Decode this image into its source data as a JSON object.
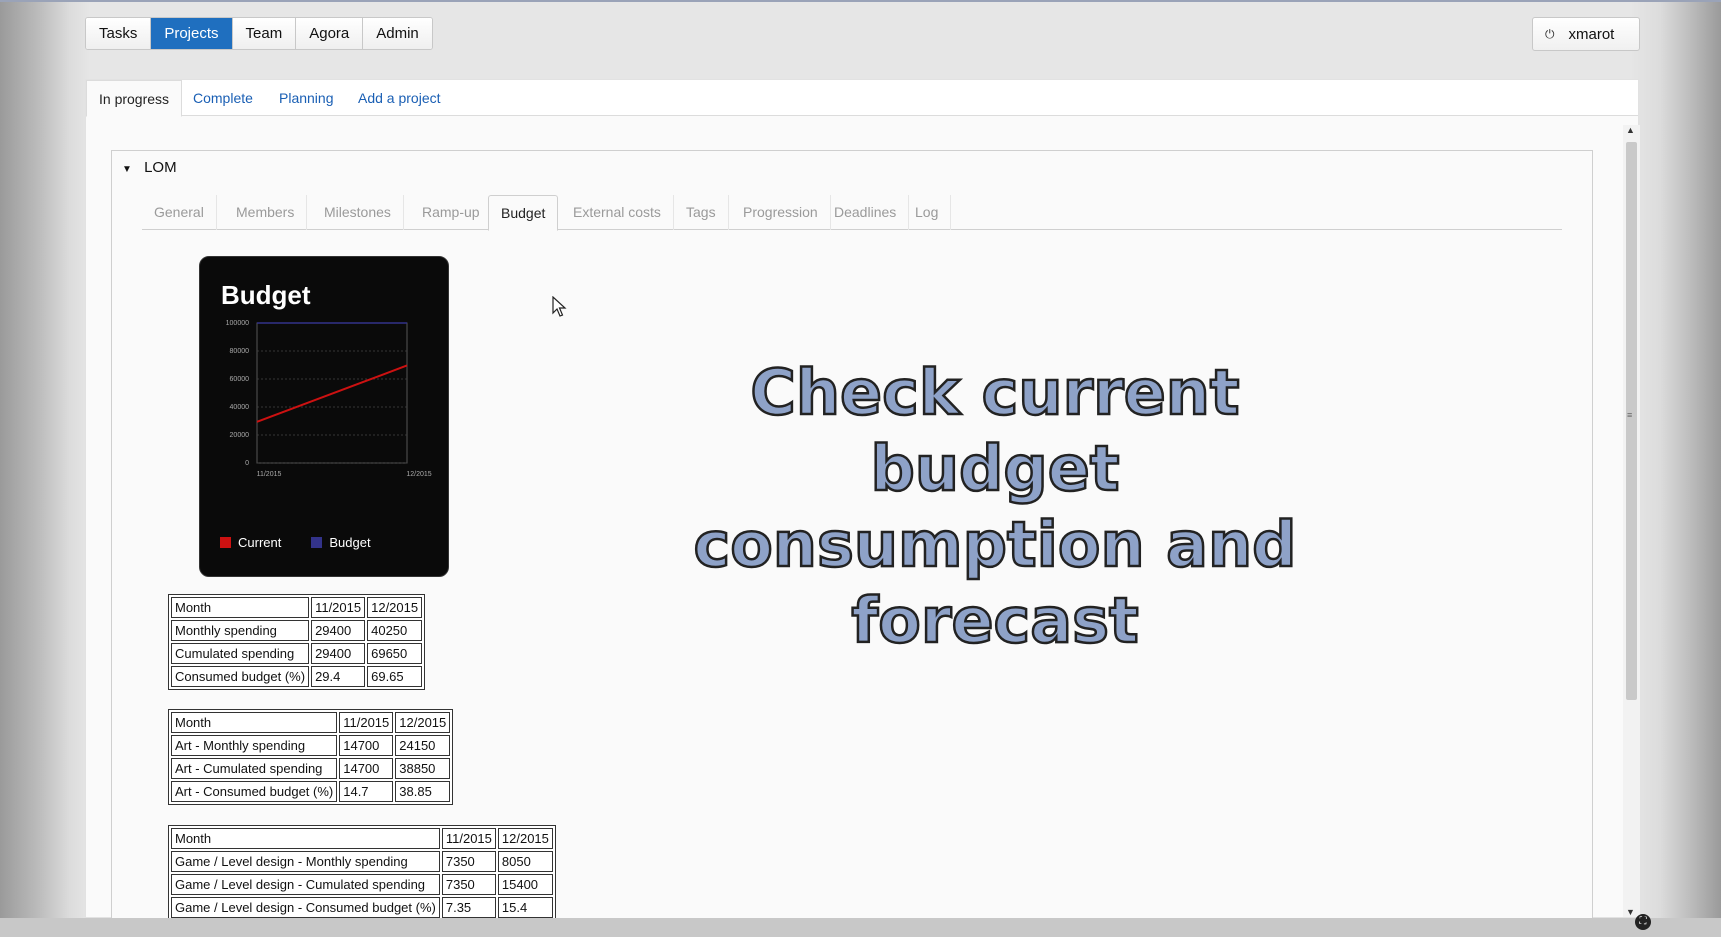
{
  "topnav": {
    "items": [
      "Tasks",
      "Projects",
      "Team",
      "Agora",
      "Admin"
    ],
    "active": "Projects"
  },
  "user": {
    "name": "xmarot",
    "icon": "power-icon"
  },
  "subtabs": [
    "In progress",
    "Complete",
    "Planning",
    "Add a project"
  ],
  "project": {
    "name": "LOM",
    "tabs": [
      "General",
      "Members",
      "Milestones",
      "Ramp-up",
      "Budget",
      "External costs",
      "Tags",
      "Progression",
      "Deadlines",
      "Log"
    ],
    "active_tab": "Budget"
  },
  "chart_data": {
    "type": "line",
    "title": "Budget",
    "categories": [
      "11/2015",
      "12/2015"
    ],
    "series": [
      {
        "name": "Current",
        "values": [
          29400,
          69650
        ],
        "color": "#cc1111"
      },
      {
        "name": "Budget",
        "values": [
          100000,
          100000
        ],
        "color": "#33338a"
      }
    ],
    "ylim": [
      0,
      100000
    ],
    "yticks": [
      "100000",
      "80000",
      "60000",
      "40000",
      "20000",
      "0"
    ],
    "grid": true,
    "legend": "bottom"
  },
  "overlay": {
    "line1": "Check current budget",
    "line2": "consumption and",
    "line3": "forecast"
  },
  "tables": [
    {
      "rows": [
        [
          "Month",
          "11/2015",
          "12/2015"
        ],
        [
          "Monthly spending",
          "29400",
          "40250"
        ],
        [
          "Cumulated spending",
          "29400",
          "69650"
        ],
        [
          "Consumed budget (%)",
          "29.4",
          "69.65"
        ]
      ]
    },
    {
      "rows": [
        [
          "Month",
          "11/2015",
          "12/2015"
        ],
        [
          "Art - Monthly spending",
          "14700",
          "24150"
        ],
        [
          "Art - Cumulated spending",
          "14700",
          "38850"
        ],
        [
          "Art - Consumed budget (%)",
          "14.7",
          "38.85"
        ]
      ]
    },
    {
      "rows": [
        [
          "Month",
          "11/2015",
          "12/2015"
        ],
        [
          "Game / Level design - Monthly spending",
          "7350",
          "8050"
        ],
        [
          "Game / Level design - Cumulated spending",
          "7350",
          "15400"
        ],
        [
          "Game / Level design - Consumed budget (%)",
          "7.35",
          "15.4"
        ]
      ]
    }
  ]
}
